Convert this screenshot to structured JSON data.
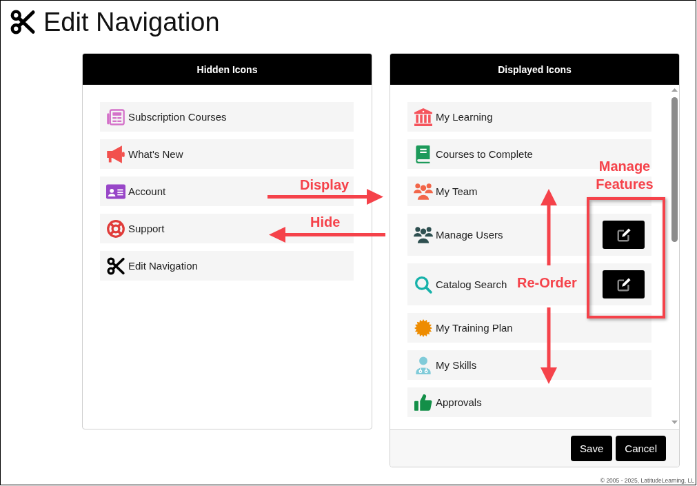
{
  "page": {
    "title": "Edit Navigation",
    "copyright": "© 2005 - 2025, LatitudeLearning, LL"
  },
  "hidden_icons": {
    "title": "Hidden Icons",
    "items": [
      {
        "label": "Subscription Courses"
      },
      {
        "label": "What's New"
      },
      {
        "label": "Account"
      },
      {
        "label": "Support"
      },
      {
        "label": "Edit Navigation"
      }
    ]
  },
  "displayed_icons": {
    "title": "Displayed Icons",
    "items": [
      {
        "label": "My Learning",
        "editable": false
      },
      {
        "label": "Courses to Complete",
        "editable": false
      },
      {
        "label": "My Team",
        "editable": false
      },
      {
        "label": "Manage Users",
        "editable": true
      },
      {
        "label": "Catalog Search",
        "editable": true
      },
      {
        "label": "My Training Plan",
        "editable": false
      },
      {
        "label": "My Skills",
        "editable": false
      },
      {
        "label": "Approvals",
        "editable": false
      }
    ],
    "buttons": [
      "Save",
      "Cancel"
    ]
  },
  "annotations": {
    "display": "Display",
    "hide": "Hide",
    "manage_features": "Manage Features",
    "reorder": "Re-Order"
  }
}
